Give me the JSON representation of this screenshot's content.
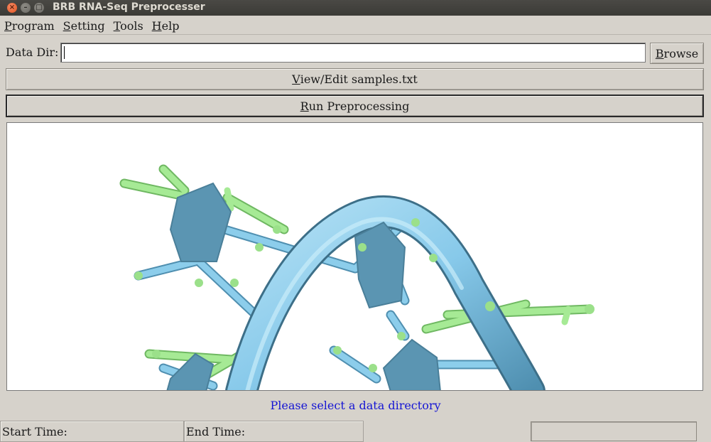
{
  "window": {
    "title": "BRB RNA-Seq Preprocesser",
    "close_glyph": "×",
    "min_glyph": "–",
    "max_glyph": "□"
  },
  "menubar": {
    "items": [
      {
        "mnemonic": "P",
        "rest": "rogram"
      },
      {
        "mnemonic": "S",
        "rest": "etting"
      },
      {
        "mnemonic": "T",
        "rest": "ools"
      },
      {
        "mnemonic": "H",
        "rest": "elp"
      }
    ]
  },
  "data_dir": {
    "label": "Data Dir:",
    "value": "",
    "browse_mnemonic": "B",
    "browse_rest": "rowse"
  },
  "buttons": {
    "view_edit_mnemonic": "V",
    "view_edit_rest": "iew/Edit samples.txt",
    "run_mnemonic": "R",
    "run_rest": "un Preprocessing"
  },
  "image_panel": {
    "icon": "rna-molecule-illustration",
    "colors": {
      "backbone": "#87c9ea",
      "backbone_dark": "#4f8fb0",
      "base_ring": "#5b95b2",
      "bond_green": "#9be08a"
    }
  },
  "status_message": "Please select a data directory",
  "status_color": "#1515d4",
  "bottom_bar": {
    "start_label": "Start Time:",
    "start_value": "",
    "end_label": "End Time:",
    "end_value": "",
    "progress": 0
  }
}
